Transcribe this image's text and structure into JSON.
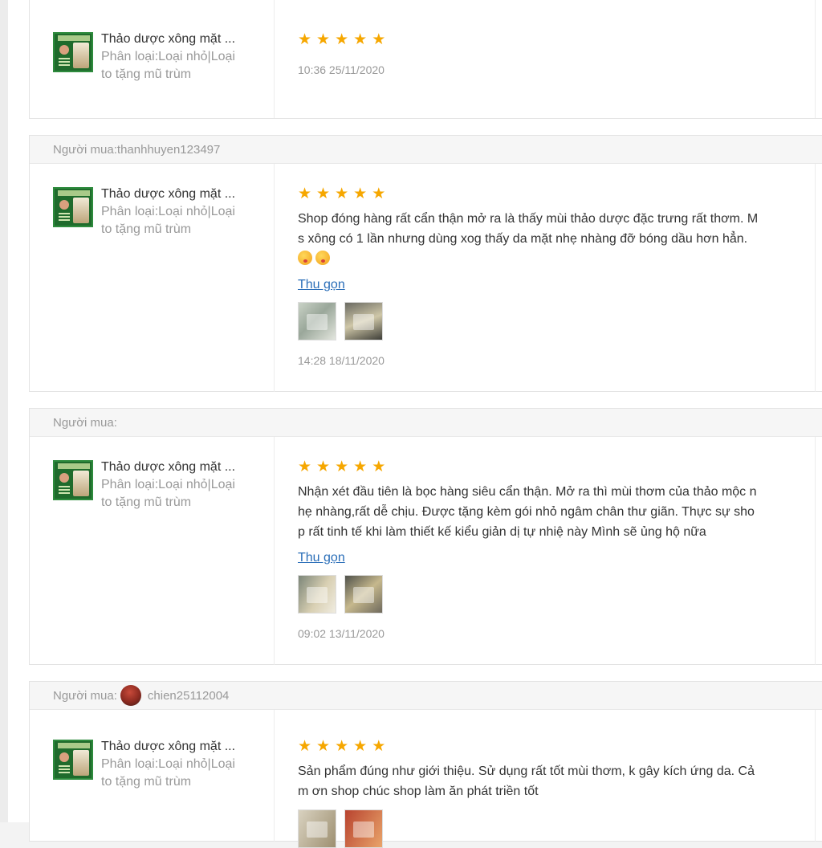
{
  "buyer_prefix": "Người mua:",
  "reviews": [
    {
      "buyer": "",
      "product_name": "Thảo dược xông mặt ...",
      "variation_line1": "Phân loại:Loại nhỏ|Loại",
      "variation_line2": "to tặng mũ trùm",
      "stars": 5,
      "comment": "",
      "time": "10:36 25/11/2020"
    },
    {
      "buyer": "thanhhuyen123497",
      "product_name": "Thảo dược xông mặt ...",
      "variation_line1": "Phân loại:Loại nhỏ|Loại",
      "variation_line2": "to tặng mũ trùm",
      "stars": 5,
      "comment_line1": "Shop đóng hàng rất cẩn thận mở ra là thấy mùi thảo dược đặc trưng rất thơm. M",
      "comment_line2": "s xông có 1 lần nhưng dùng xog thấy da mặt nhẹ nhàng đỡ bóng dầu hơn hẳn.",
      "collapse": "Thu gọn",
      "time": "14:28 18/11/2020"
    },
    {
      "buyer": "",
      "product_name": "Thảo dược xông mặt ...",
      "variation_line1": "Phân loại:Loại nhỏ|Loại",
      "variation_line2": "to tặng mũ trùm",
      "stars": 5,
      "comment_line1": "Nhận xét đầu tiên là bọc hàng siêu cẩn thận. Mở ra thì mùi thơm của thảo mộc n",
      "comment_line2": "hẹ nhàng,rất dễ chịu. Được tặng kèm gói nhỏ ngâm chân thư giãn. Thực sự sho",
      "comment_line3": "p rất tinh tế khi làm thiết kế kiểu giản dị tự nhiệ này Mình sẽ ủng hộ nữa",
      "collapse": "Thu gọn",
      "time": "09:02 13/11/2020"
    },
    {
      "buyer": "chien25112004",
      "product_name": "Thảo dược xông mặt ...",
      "variation_line1": "Phân loại:Loại nhỏ|Loại",
      "variation_line2": "to tặng mũ trùm",
      "stars": 5,
      "comment_line1": "Sản phẩm đúng như giới thiệu. Sử dụng rất tốt mùi thơm, k gây kích ứng da. Cả",
      "comment_line2": "m ơn shop chúc shop làm ăn phát triền tốt"
    }
  ]
}
